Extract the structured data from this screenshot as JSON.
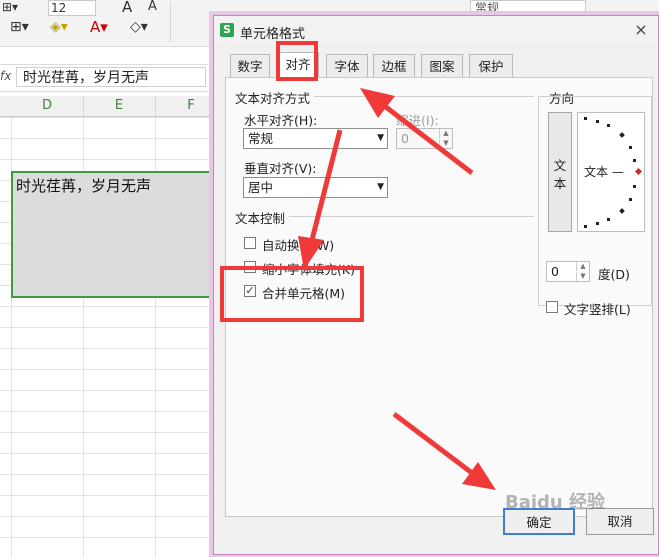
{
  "spreadsheet": {
    "toolbar": {
      "font_size_value": "12",
      "number_format_value": "常规",
      "font_grow": "A",
      "font_shrink": "A",
      "font_color_glyph": "A"
    },
    "formula_bar": {
      "fx": "fx",
      "content": "时光荏苒，岁月无声"
    },
    "columns": [
      "D",
      "E",
      "F"
    ],
    "merged_cell_text": "时光荏苒，岁月无声"
  },
  "dialog": {
    "title": "单元格格式",
    "close": "×",
    "app_icon_glyph": "S",
    "tabs": [
      {
        "label": "数字"
      },
      {
        "label": "对齐"
      },
      {
        "label": "字体"
      },
      {
        "label": "边框"
      },
      {
        "label": "图案"
      },
      {
        "label": "保护"
      }
    ],
    "active_tab": "对齐",
    "text_alignment": {
      "group_title": "文本对齐方式",
      "horizontal_label": "水平对齐(H):",
      "horizontal_value": "常规",
      "indent_label": "缩进(I):",
      "indent_value": "0",
      "vertical_label": "垂直对齐(V):",
      "vertical_value": "居中"
    },
    "text_control": {
      "group_title": "文本控制",
      "wrap_text": {
        "label": "自动换行(W)",
        "checked": false
      },
      "shrink_to_fit": {
        "label": "缩小字体填充(K)",
        "checked": false
      },
      "merge_cells": {
        "label": "合并单元格(M)",
        "checked": true
      }
    },
    "orientation": {
      "group_title": "方向",
      "vertical_text": [
        "文",
        "本"
      ],
      "dial_text": "文本 —",
      "degrees_value": "0",
      "degrees_label": "度(D)",
      "vertical_layout": {
        "label": "文字竖排(L)",
        "checked": false
      }
    },
    "buttons": {
      "ok": "确定",
      "cancel": "取消"
    }
  },
  "watermark": "Baidu 经验",
  "colors": {
    "annotation_red": "#f03a3a",
    "selection_green": "#3f9b3f",
    "dialog_border": "#c586c0"
  }
}
